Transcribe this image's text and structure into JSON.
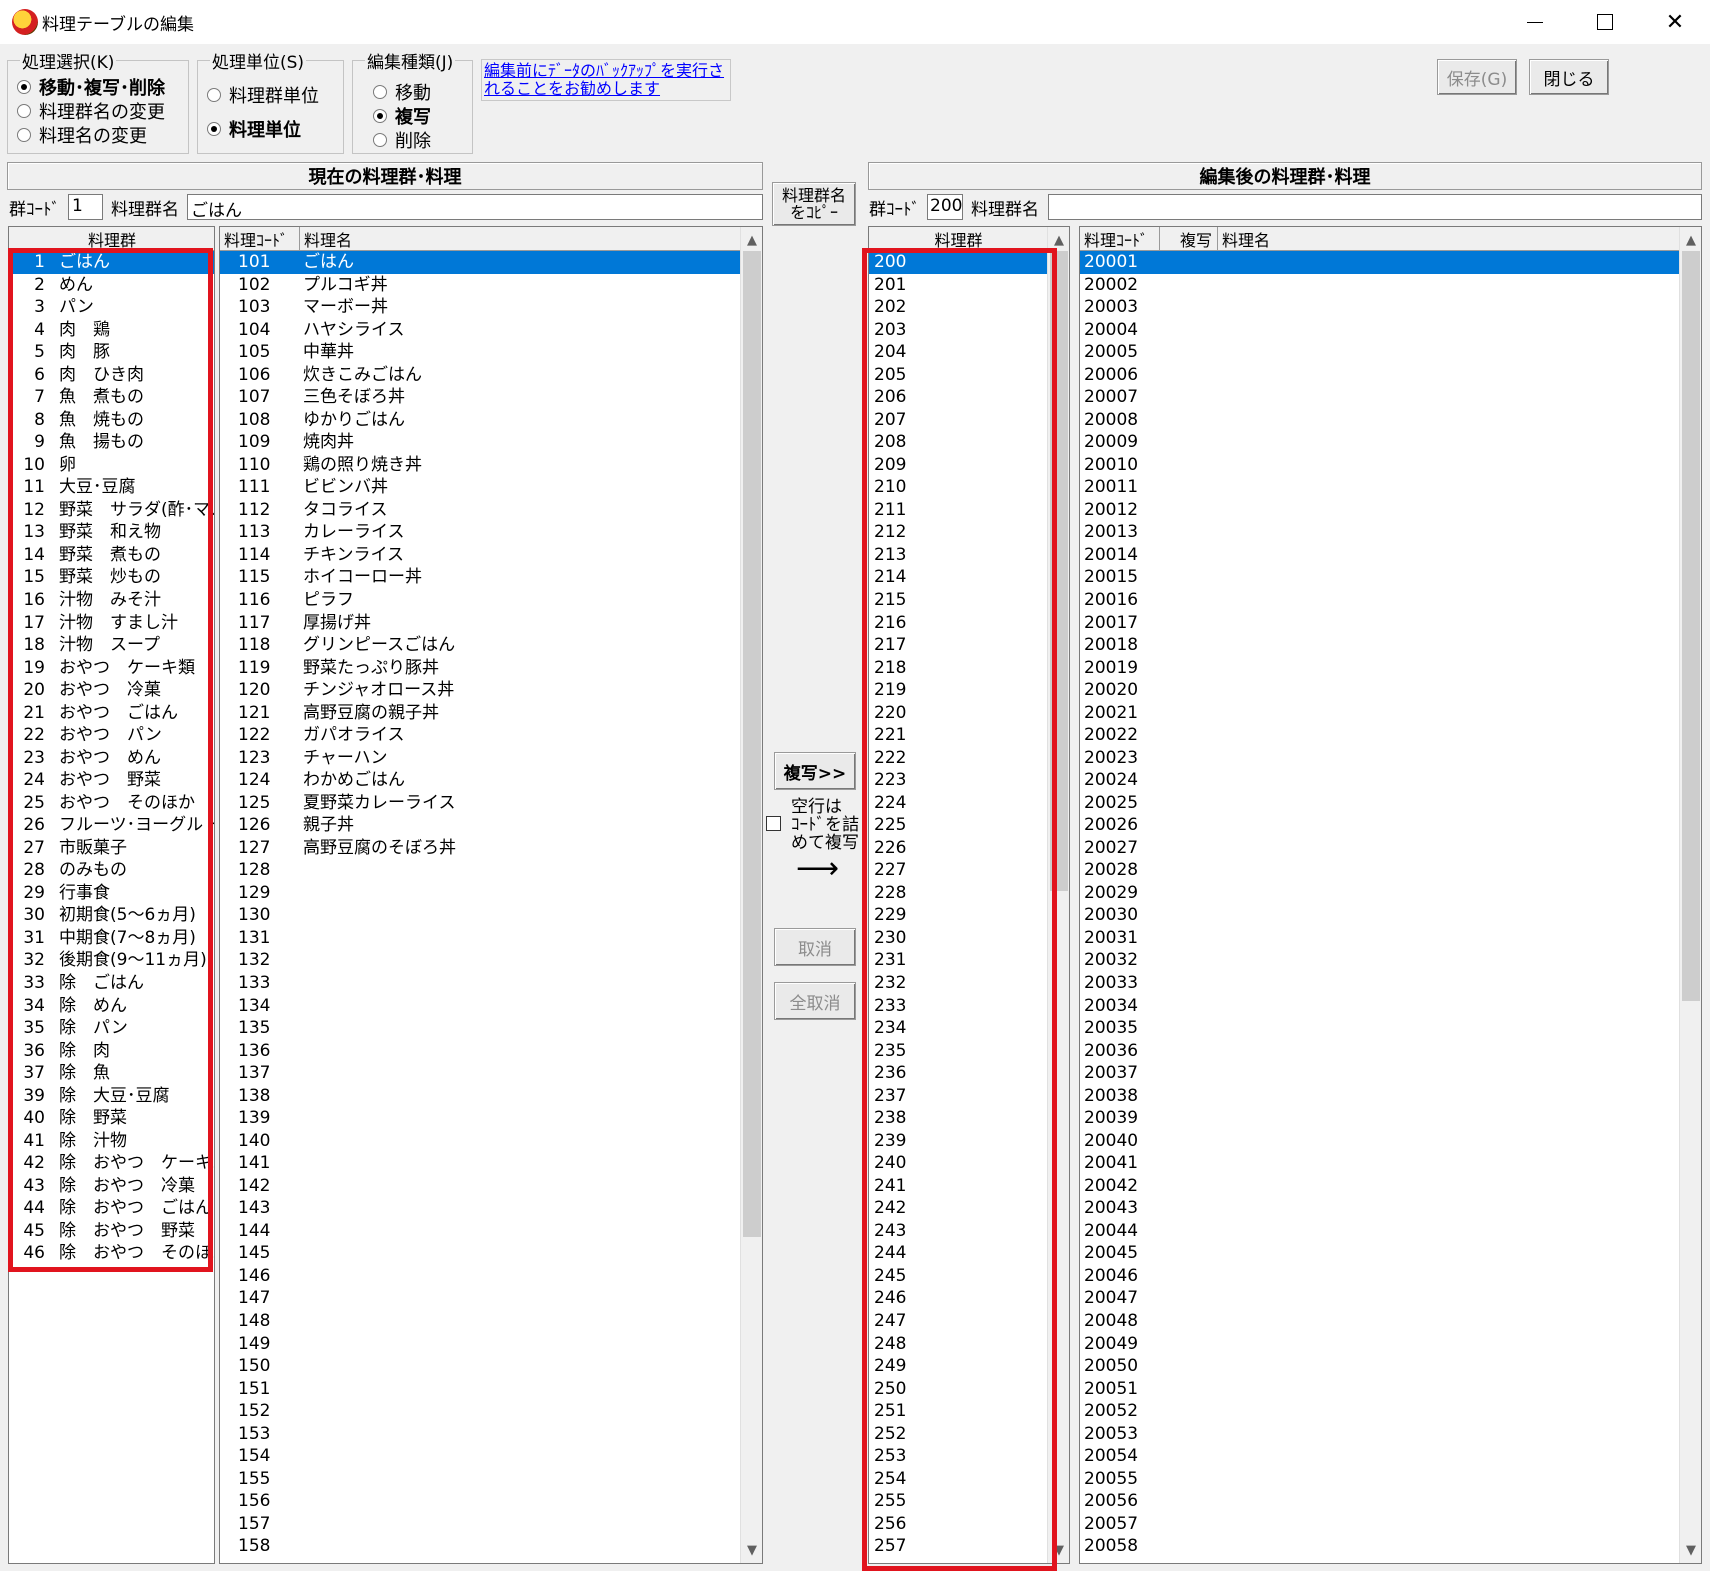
{
  "window": {
    "title": "料理テーブルの編集"
  },
  "groups": {
    "process_select": {
      "legend": "処理選択(K)",
      "options": [
        "移動･複写･削除",
        "料理群名の変更",
        "料理名の変更"
      ],
      "selected": 0
    },
    "process_unit": {
      "legend": "処理単位(S)",
      "options": [
        "料理群単位",
        "料理単位"
      ],
      "selected": 1
    },
    "edit_type": {
      "legend": "編集種類(J)",
      "options": [
        "移動",
        "複写",
        "削除"
      ],
      "selected": 1
    }
  },
  "note": "編集前にﾃﾞｰﾀのﾊﾞｯｸｱｯﾌﾟを実行されることをお勧めします",
  "buttons": {
    "save": "保存(G)",
    "close": "閉じる",
    "copy_group_name": "料理群名をｺﾋﾟｰ",
    "copy": "複写>>",
    "cancel": "取消",
    "cancel_all": "全取消"
  },
  "checkbox_label": [
    "空行は",
    "ｺｰﾄﾞを詰",
    "めて複写"
  ],
  "arrow": "⟶",
  "left": {
    "header": "現在の料理群･料理",
    "group_code_label": "群ｺｰﾄﾞ",
    "group_code": "1",
    "group_name_label": "料理群名",
    "group_name": "ごはん",
    "groups_col": "料理群",
    "code_col": "料理ｺｰﾄﾞ",
    "name_col": "料理名",
    "groups": [
      [
        "1",
        "ごはん"
      ],
      [
        "2",
        "めん"
      ],
      [
        "3",
        "パン"
      ],
      [
        "4",
        "肉　鶏"
      ],
      [
        "5",
        "肉　豚"
      ],
      [
        "6",
        "肉　ひき肉"
      ],
      [
        "7",
        "魚　煮もの"
      ],
      [
        "8",
        "魚　焼もの"
      ],
      [
        "9",
        "魚　揚もの"
      ],
      [
        "10",
        "卵"
      ],
      [
        "11",
        "大豆･豆腐"
      ],
      [
        "12",
        "野菜　サラダ(酢･マ…"
      ],
      [
        "13",
        "野菜　和え物"
      ],
      [
        "14",
        "野菜　煮もの"
      ],
      [
        "15",
        "野菜　炒もの"
      ],
      [
        "16",
        "汁物　みそ汁"
      ],
      [
        "17",
        "汁物　すまし汁"
      ],
      [
        "18",
        "汁物　スープ"
      ],
      [
        "19",
        "おやつ　ケーキ類"
      ],
      [
        "20",
        "おやつ　冷菓"
      ],
      [
        "21",
        "おやつ　ごはん"
      ],
      [
        "22",
        "おやつ　パン"
      ],
      [
        "23",
        "おやつ　めん"
      ],
      [
        "24",
        "おやつ　野菜"
      ],
      [
        "25",
        "おやつ　そのほか"
      ],
      [
        "26",
        "フルーツ･ヨーグルト"
      ],
      [
        "27",
        "市販菓子"
      ],
      [
        "28",
        "のみもの"
      ],
      [
        "29",
        "行事食"
      ],
      [
        "30",
        "初期食(5～6ヵ月)"
      ],
      [
        "31",
        "中期食(7～8ヵ月)"
      ],
      [
        "32",
        "後期食(9～11ヵ月)"
      ],
      [
        "33",
        "除　ごはん"
      ],
      [
        "34",
        "除　めん"
      ],
      [
        "35",
        "除　パン"
      ],
      [
        "36",
        "除　肉"
      ],
      [
        "37",
        "除　魚"
      ],
      [
        "39",
        "除　大豆･豆腐"
      ],
      [
        "40",
        "除　野菜"
      ],
      [
        "41",
        "除　汁物"
      ],
      [
        "42",
        "除　おやつ　ケーキ…"
      ],
      [
        "43",
        "除　おやつ　冷菓"
      ],
      [
        "44",
        "除　おやつ　ごはん"
      ],
      [
        "45",
        "除　おやつ　野菜"
      ],
      [
        "46",
        "除　おやつ　そのほ…"
      ]
    ],
    "dishes": [
      [
        "101",
        "ごはん"
      ],
      [
        "102",
        "プルコギ丼"
      ],
      [
        "103",
        "マーボー丼"
      ],
      [
        "104",
        "ハヤシライス"
      ],
      [
        "105",
        "中華丼"
      ],
      [
        "106",
        "炊きこみごはん"
      ],
      [
        "107",
        "三色そぼろ丼"
      ],
      [
        "108",
        "ゆかりごはん"
      ],
      [
        "109",
        "焼肉丼"
      ],
      [
        "110",
        "鶏の照り焼き丼"
      ],
      [
        "111",
        "ビビンバ丼"
      ],
      [
        "112",
        "タコライス"
      ],
      [
        "113",
        "カレーライス"
      ],
      [
        "114",
        "チキンライス"
      ],
      [
        "115",
        "ホイコーロー丼"
      ],
      [
        "116",
        "ピラフ"
      ],
      [
        "117",
        "厚揚げ丼"
      ],
      [
        "118",
        "グリンピースごはん"
      ],
      [
        "119",
        "野菜たっぷり豚丼"
      ],
      [
        "120",
        "チンジャオロース丼"
      ],
      [
        "121",
        "高野豆腐の親子丼"
      ],
      [
        "122",
        "ガパオライス"
      ],
      [
        "123",
        "チャーハン"
      ],
      [
        "124",
        "わかめごはん"
      ],
      [
        "125",
        "夏野菜カレーライス"
      ],
      [
        "126",
        "親子丼"
      ],
      [
        "127",
        "高野豆腐のそぼろ丼"
      ],
      [
        "128",
        ""
      ],
      [
        "129",
        ""
      ],
      [
        "130",
        ""
      ],
      [
        "131",
        ""
      ],
      [
        "132",
        ""
      ],
      [
        "133",
        ""
      ],
      [
        "134",
        ""
      ],
      [
        "135",
        ""
      ],
      [
        "136",
        ""
      ],
      [
        "137",
        ""
      ],
      [
        "138",
        ""
      ],
      [
        "139",
        ""
      ],
      [
        "140",
        ""
      ],
      [
        "141",
        ""
      ],
      [
        "142",
        ""
      ],
      [
        "143",
        ""
      ],
      [
        "144",
        ""
      ],
      [
        "145",
        ""
      ],
      [
        "146",
        ""
      ],
      [
        "147",
        ""
      ],
      [
        "148",
        ""
      ],
      [
        "149",
        ""
      ],
      [
        "150",
        ""
      ],
      [
        "151",
        ""
      ],
      [
        "152",
        ""
      ],
      [
        "153",
        ""
      ],
      [
        "154",
        ""
      ],
      [
        "155",
        ""
      ],
      [
        "156",
        ""
      ],
      [
        "157",
        ""
      ],
      [
        "158",
        ""
      ]
    ]
  },
  "right": {
    "header": "編集後の料理群･料理",
    "group_code_label": "群ｺｰﾄﾞ",
    "group_code": "200",
    "group_name_label": "料理群名",
    "group_name": "",
    "groups_col": "料理群",
    "code_col": "料理ｺｰﾄﾞ",
    "copy_col": "複写",
    "name_col": "料理名",
    "groups": [
      "200",
      "201",
      "202",
      "203",
      "204",
      "205",
      "206",
      "207",
      "208",
      "209",
      "210",
      "211",
      "212",
      "213",
      "214",
      "215",
      "216",
      "217",
      "218",
      "219",
      "220",
      "221",
      "222",
      "223",
      "224",
      "225",
      "226",
      "227",
      "228",
      "229",
      "230",
      "231",
      "232",
      "233",
      "234",
      "235",
      "236",
      "237",
      "238",
      "239",
      "240",
      "241",
      "242",
      "243",
      "244",
      "245",
      "246",
      "247",
      "248",
      "249",
      "250",
      "251",
      "252",
      "253",
      "254",
      "255",
      "256",
      "257"
    ],
    "dishes": [
      "20001",
      "20002",
      "20003",
      "20004",
      "20005",
      "20006",
      "20007",
      "20008",
      "20009",
      "20010",
      "20011",
      "20012",
      "20013",
      "20014",
      "20015",
      "20016",
      "20017",
      "20018",
      "20019",
      "20020",
      "20021",
      "20022",
      "20023",
      "20024",
      "20025",
      "20026",
      "20027",
      "20028",
      "20029",
      "20030",
      "20031",
      "20032",
      "20033",
      "20034",
      "20035",
      "20036",
      "20037",
      "20038",
      "20039",
      "20040",
      "20041",
      "20042",
      "20043",
      "20044",
      "20045",
      "20046",
      "20047",
      "20048",
      "20049",
      "20050",
      "20051",
      "20052",
      "20053",
      "20054",
      "20055",
      "20056",
      "20057",
      "20058"
    ]
  },
  "colors": {
    "selection": "#0078d7",
    "highlight_box": "#e1141e",
    "note_text": "#0000ff"
  }
}
